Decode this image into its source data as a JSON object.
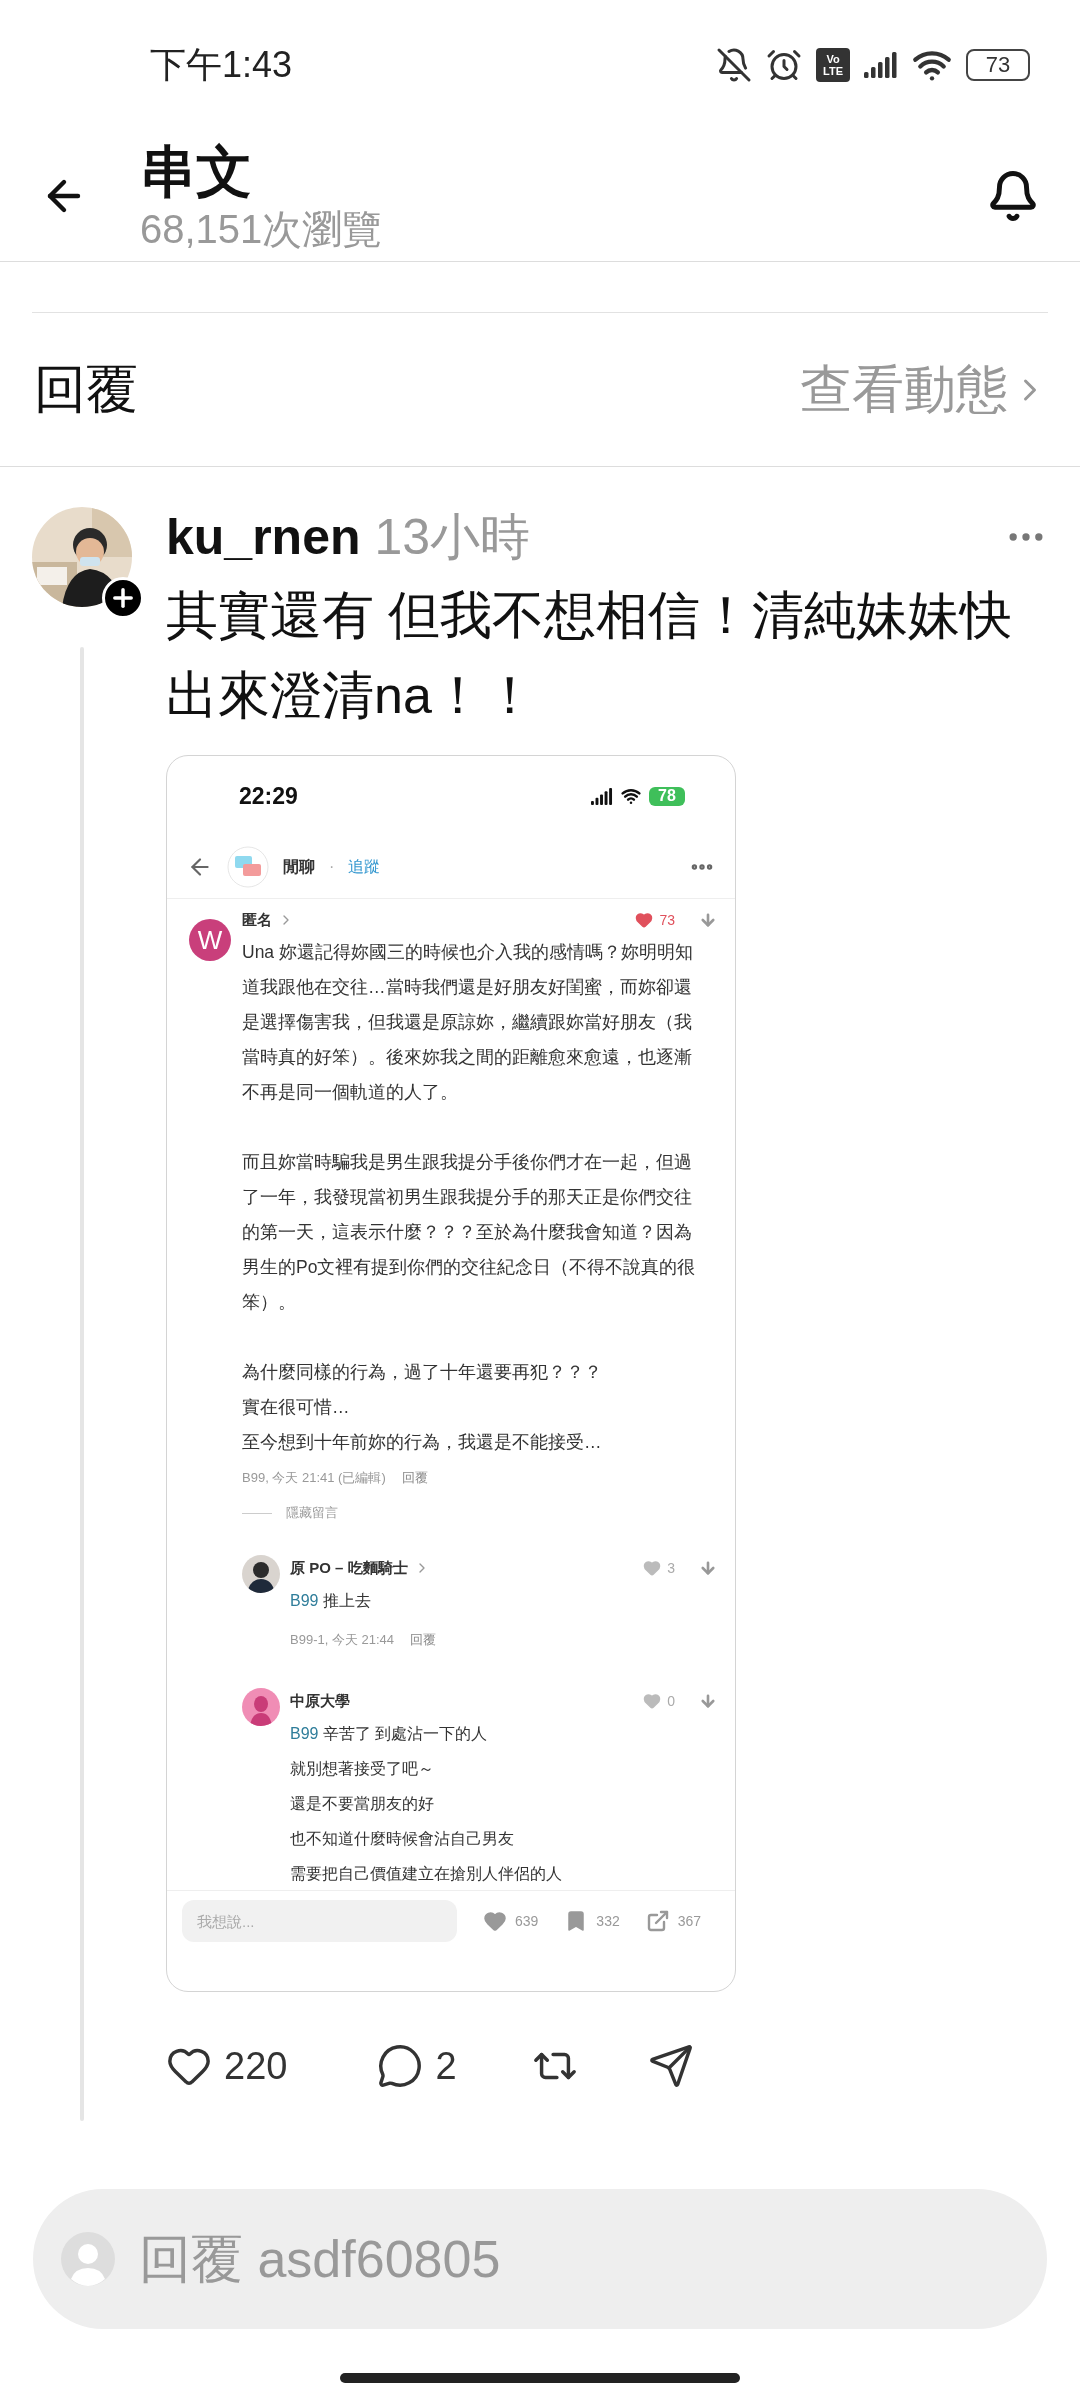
{
  "status_bar": {
    "time": "下午1:43",
    "network_badge": [
      "Vo",
      "LTE"
    ],
    "battery": "73"
  },
  "header": {
    "title": "串文",
    "views": "68,151次瀏覽"
  },
  "replies_header": {
    "label": "回覆",
    "link": "查看動態"
  },
  "post": {
    "username": "ku_rnen",
    "time": "13小時",
    "text": "其實還有 但我不想相信！清純妹妹快出來澄清na！！",
    "screenshot": {
      "status_bar": {
        "time": "22:29",
        "battery": "78"
      },
      "forum": {
        "name": "閒聊",
        "separator": "·",
        "follow": "追蹤"
      },
      "comment": {
        "avatar_letter": "W",
        "author": "匿名",
        "chevron": true,
        "liked": true,
        "likes": "73",
        "paragraphs": [
          [
            "Una 妳還記得妳國三的時候也介入我的感情嗎？妳明明知",
            "道我跟他在交往…當時我們還是好朋友好閨蜜，而妳卻還",
            "是選擇傷害我，但我還是原諒妳，繼續跟妳當好朋友（我",
            "當時真的好笨）。後來妳我之間的距離愈來愈遠，也逐漸",
            "不再是同一個軌道的人了。"
          ],
          [
            "而且妳當時騙我是男生跟我提分手後你們才在一起，但過",
            "了一年，我發現當初男生跟我提分手的那天正是你們交往",
            "的第一天，這表示什麼？？？至於為什麼我會知道？因為",
            "男生的Po文裡有提到你們的交往紀念日（不得不說真的很",
            "笨）。"
          ],
          [
            "為什麼同樣的行為，過了十年還要再犯？？？",
            "實在很可惜…",
            "至今想到十年前妳的行為，我還是不能接受…"
          ]
        ],
        "meta": "B99, 今天 21:41 (已編輯)",
        "reply": "回覆"
      },
      "hide_label": "隱藏留言",
      "replies": [
        {
          "author": "原 PO – 吃麵騎士",
          "chevron": true,
          "liked": false,
          "likes": "3",
          "mention": "B99",
          "lines": [
            "推上去"
          ],
          "meta": "B99-1, 今天 21:44",
          "reply": "回覆"
        },
        {
          "kind": "default",
          "author": "中原大學",
          "chevron": false,
          "liked": false,
          "likes": "0",
          "mention": "B99",
          "lines": [
            "辛苦了 到處沾一下的人",
            "就別想著接受了吧～",
            "還是不要當朋友的好",
            "也不知道什麼時候會沾自己男友",
            "需要把自己價值建立在搶別人伴侶的人"
          ]
        }
      ],
      "composer": {
        "placeholder": "我想說..."
      },
      "stats": [
        {
          "kind": "like",
          "count": "639"
        },
        {
          "kind": "bookmark",
          "count": "332"
        },
        {
          "kind": "share",
          "count": "367"
        }
      ]
    },
    "actions": [
      {
        "kind": "like",
        "count": "220"
      },
      {
        "kind": "comment",
        "count": "2"
      },
      {
        "kind": "repost"
      },
      {
        "kind": "share"
      }
    ]
  },
  "reply_field": {
    "placeholder": "回覆 asdf60805"
  }
}
